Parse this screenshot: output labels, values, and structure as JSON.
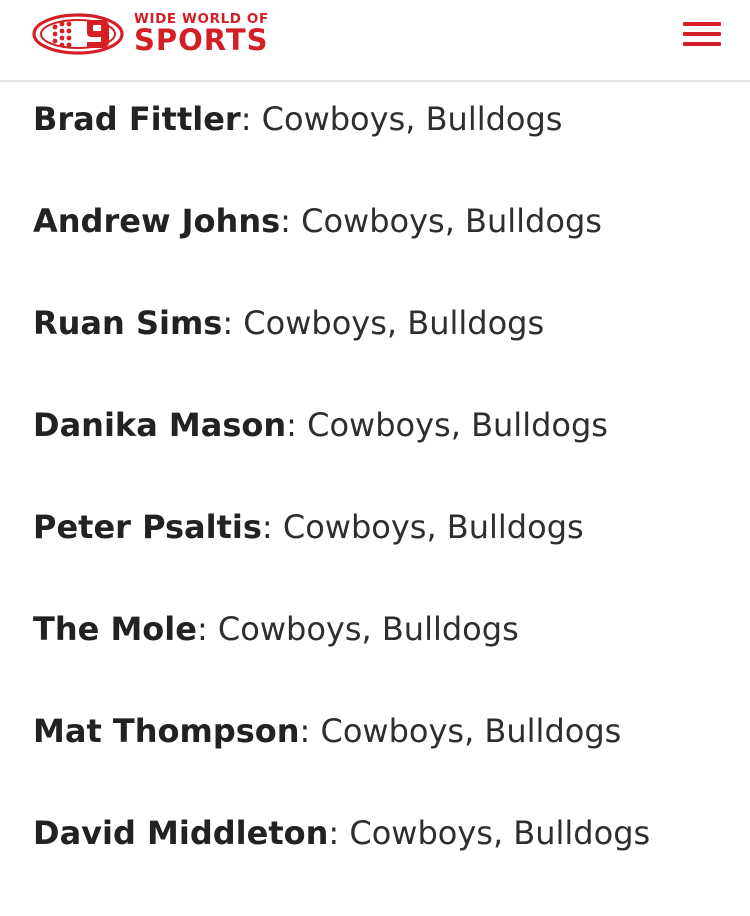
{
  "header": {
    "logo_line1": "WIDE WORLD OF",
    "logo_line2": "SPORTS",
    "brand_color": "#d41f26"
  },
  "menu": {
    "icon": "hamburger-menu-icon"
  },
  "tips": [
    {
      "name": "Brad Fittler",
      "separator": ": ",
      "teams": "Cowboys, Bulldogs"
    },
    {
      "name": "Andrew Johns",
      "separator": ": ",
      "teams": "Cowboys, Bulldogs"
    },
    {
      "name": "Ruan Sims",
      "separator": ": ",
      "teams": "Cowboys, Bulldogs"
    },
    {
      "name": "Danika Mason",
      "separator": ": ",
      "teams": "Cowboys, Bulldogs"
    },
    {
      "name": "Peter Psaltis",
      "separator": ": ",
      "teams": "Cowboys, Bulldogs"
    },
    {
      "name": "The Mole",
      "separator": ": ",
      "teams": "Cowboys, Bulldogs"
    },
    {
      "name": "Mat Thompson",
      "separator": ": ",
      "teams": "Cowboys, Bulldogs"
    },
    {
      "name": "David Middleton",
      "separator": ": ",
      "teams": "Cowboys, Bulldogs"
    }
  ]
}
